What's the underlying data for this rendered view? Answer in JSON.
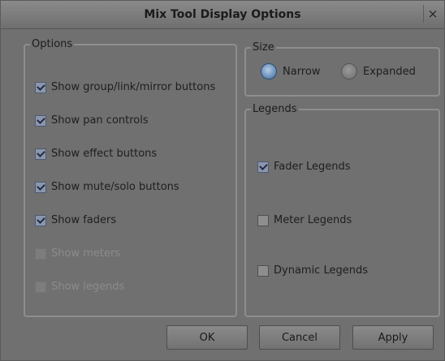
{
  "window": {
    "title": "Mix Tool Display Options",
    "close_glyph": "×"
  },
  "options": {
    "label": "Options",
    "items": [
      {
        "label": "Show group/link/mirror buttons",
        "checked": true,
        "enabled": true
      },
      {
        "label": "Show pan controls",
        "checked": true,
        "enabled": true
      },
      {
        "label": "Show effect buttons",
        "checked": true,
        "enabled": true
      },
      {
        "label": "Show mute/solo buttons",
        "checked": true,
        "enabled": true
      },
      {
        "label": "Show faders",
        "checked": true,
        "enabled": true
      },
      {
        "label": "Show meters",
        "checked": false,
        "enabled": false
      },
      {
        "label": "Show legends",
        "checked": false,
        "enabled": false
      }
    ]
  },
  "size": {
    "label": "Size",
    "narrow": "Narrow",
    "expanded": "Expanded",
    "selected": "Narrow"
  },
  "legends": {
    "label": "Legends",
    "items": [
      {
        "label": "Fader Legends",
        "checked": true
      },
      {
        "label": "Meter Legends",
        "checked": false
      },
      {
        "label": "Dynamic Legends",
        "checked": false
      }
    ]
  },
  "buttons": {
    "ok": "OK",
    "cancel": "Cancel",
    "apply": "Apply"
  }
}
